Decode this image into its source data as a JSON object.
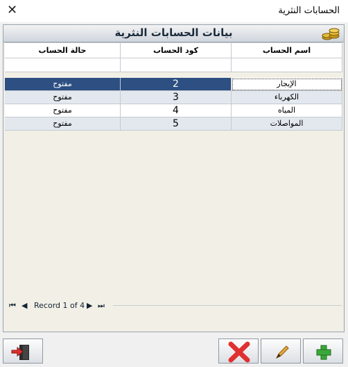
{
  "window": {
    "title": "الحسابات النثرية"
  },
  "header": {
    "title": "بيانات الحسابات النثرية"
  },
  "grid": {
    "columns": {
      "status": "حالة الحساب",
      "code": "كود الحساب",
      "name": "اسم الحساب"
    },
    "rows": [
      {
        "status": "مفتوح",
        "code": "2",
        "name": "الإيجار"
      },
      {
        "status": "مفتوح",
        "code": "3",
        "name": "الكهرباء"
      },
      {
        "status": "مفتوح",
        "code": "4",
        "name": "المياه"
      },
      {
        "status": "مفتوح",
        "code": "5",
        "name": "المواصلات"
      }
    ]
  },
  "navigation": {
    "first": "⏮",
    "prev": "◀",
    "record": "Record 1 of 4",
    "next": "▶",
    "last": "⏭"
  },
  "colors": {
    "selected_row": "#2d4f82",
    "alt_row": "#e3e8ef",
    "add": "#3aa83a",
    "delete": "#e03030"
  },
  "icons": [
    "close-icon",
    "coins-icon",
    "exit-icon",
    "delete-icon",
    "edit-icon",
    "add-icon"
  ]
}
